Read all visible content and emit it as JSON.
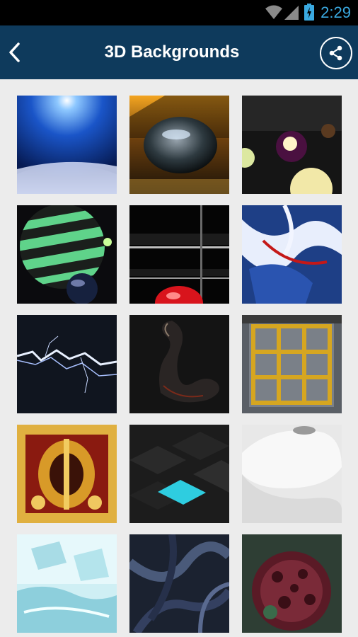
{
  "status_bar": {
    "time": "2:29",
    "icons": [
      "wifi-icon",
      "signal-icon",
      "battery-charging-icon"
    ],
    "time_color": "#3aa9e0"
  },
  "app_bar": {
    "title": "3D Backgrounds",
    "back_icon": "back-arrow-icon",
    "share_icon": "share-icon",
    "background": "#0e3a5c"
  },
  "gallery": {
    "items": [
      "blue-light-sphere",
      "glass-sphere-amber",
      "glowing-balls-dark",
      "green-striped-sphere",
      "black-panels-red-sphere",
      "blue-white-abstract",
      "lightning-bolt",
      "black-swan-sculpture",
      "gold-cube-lattice",
      "gold-red-ornament",
      "black-tiles-cyan",
      "white-curved-object",
      "ice-water-blocks",
      "dark-twisted-tubes",
      "red-spiky-virus"
    ]
  }
}
